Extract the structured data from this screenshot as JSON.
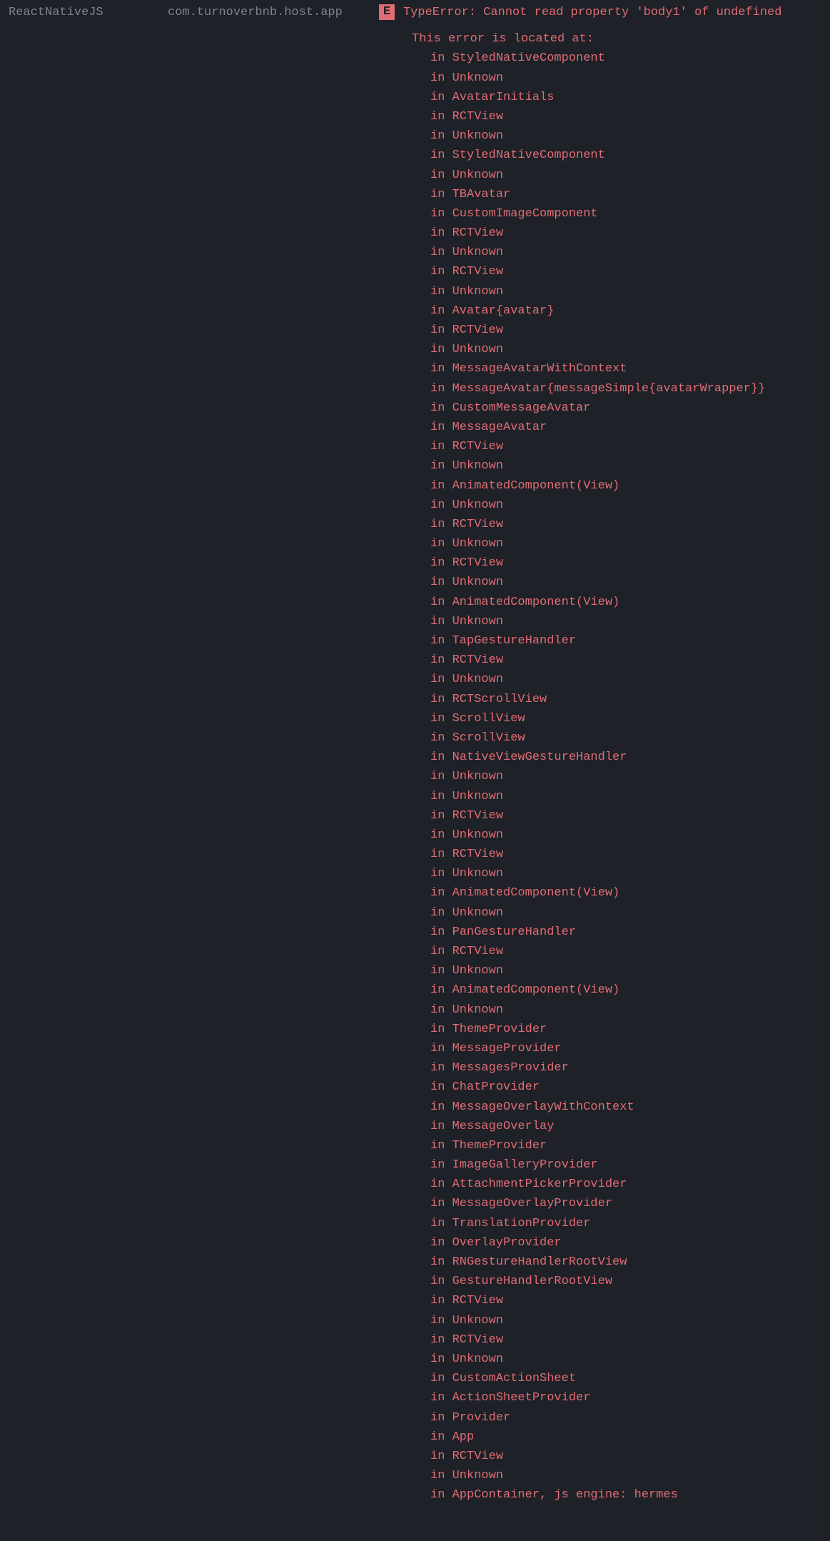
{
  "header": {
    "tag": "ReactNativeJS",
    "package": "com.turnoverbnb.host.app",
    "level": "E",
    "message": "TypeError: Cannot read property 'body1' of undefined"
  },
  "error": {
    "heading": "This error is located at:",
    "stack": [
      "StyledNativeComponent",
      "Unknown",
      "AvatarInitials",
      "RCTView",
      "Unknown",
      "StyledNativeComponent",
      "Unknown",
      "TBAvatar",
      "CustomImageComponent",
      "RCTView",
      "Unknown",
      "RCTView",
      "Unknown",
      "Avatar{avatar}",
      "RCTView",
      "Unknown",
      "MessageAvatarWithContext",
      "MessageAvatar{messageSimple{avatarWrapper}}",
      "CustomMessageAvatar",
      "MessageAvatar",
      "RCTView",
      "Unknown",
      "AnimatedComponent(View)",
      "Unknown",
      "RCTView",
      "Unknown",
      "RCTView",
      "Unknown",
      "AnimatedComponent(View)",
      "Unknown",
      "TapGestureHandler",
      "RCTView",
      "Unknown",
      "RCTScrollView",
      "ScrollView",
      "ScrollView",
      "NativeViewGestureHandler",
      "Unknown",
      "Unknown",
      "RCTView",
      "Unknown",
      "RCTView",
      "Unknown",
      "AnimatedComponent(View)",
      "Unknown",
      "PanGestureHandler",
      "RCTView",
      "Unknown",
      "AnimatedComponent(View)",
      "Unknown",
      "ThemeProvider",
      "MessageProvider",
      "MessagesProvider",
      "ChatProvider",
      "MessageOverlayWithContext",
      "MessageOverlay",
      "ThemeProvider",
      "ImageGalleryProvider",
      "AttachmentPickerProvider",
      "MessageOverlayProvider",
      "TranslationProvider",
      "OverlayProvider",
      "RNGestureHandlerRootView",
      "GestureHandlerRootView",
      "RCTView",
      "Unknown",
      "RCTView",
      "Unknown",
      "CustomActionSheet",
      "ActionSheetProvider",
      "Provider",
      "App",
      "RCTView",
      "Unknown",
      "AppContainer, js engine: hermes"
    ]
  }
}
